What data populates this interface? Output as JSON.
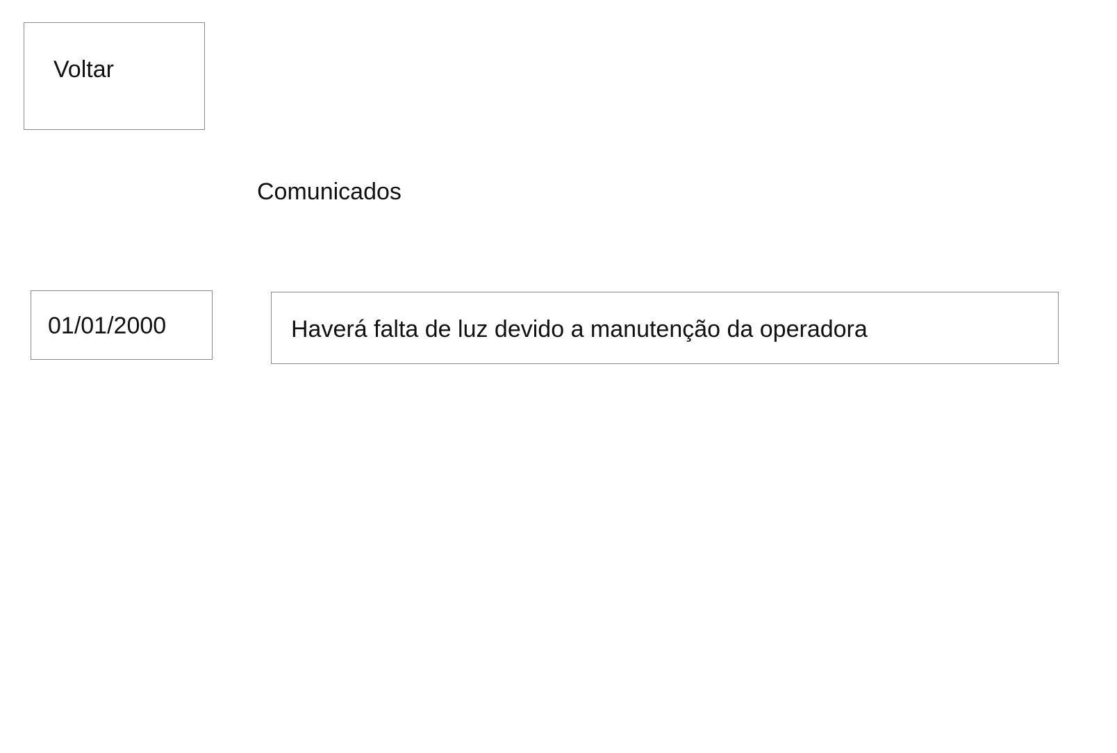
{
  "nav": {
    "back_label": "Voltar"
  },
  "page": {
    "title": "Comunicados"
  },
  "notices": [
    {
      "date": "01/01/2000",
      "message": "Haverá falta de luz devido a manutenção da operadora"
    }
  ]
}
